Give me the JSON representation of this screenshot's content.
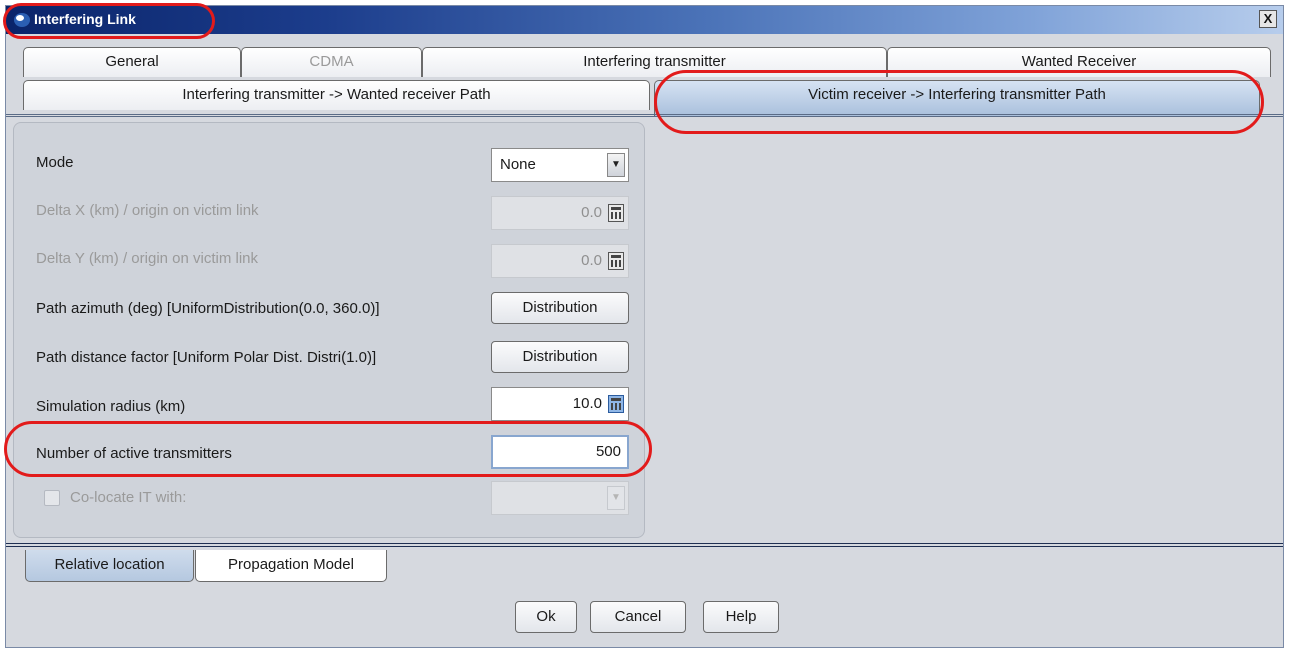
{
  "window": {
    "title": "Interfering Link",
    "close_label": "X"
  },
  "tabs_row1": [
    {
      "label": "General",
      "enabled": true
    },
    {
      "label": "CDMA",
      "enabled": false
    },
    {
      "label": "Interfering transmitter",
      "enabled": true
    },
    {
      "label": "Wanted Receiver",
      "enabled": true
    }
  ],
  "tabs_row2": [
    {
      "label": "Interfering transmitter -> Wanted receiver Path",
      "selected": false
    },
    {
      "label": "Victim receiver -> Interfering transmitter Path",
      "selected": true
    }
  ],
  "form": {
    "mode": {
      "label": "Mode",
      "value": "None"
    },
    "delta_x": {
      "label": "Delta X (km) / origin on victim link",
      "value": "0.0",
      "enabled": false
    },
    "delta_y": {
      "label": "Delta Y (km) / origin on victim link",
      "value": "0.0",
      "enabled": false
    },
    "path_azimuth": {
      "label": "Path azimuth (deg) [UniformDistribution(0.0, 360.0)]",
      "button_label": "Distribution"
    },
    "path_distance": {
      "label": "Path distance factor [Uniform Polar Dist. Distri(1.0)]",
      "button_label": "Distribution"
    },
    "sim_radius": {
      "label": "Simulation radius (km)",
      "value": "10.0"
    },
    "active_tx": {
      "label": "Number of active transmitters",
      "value": "500"
    },
    "colocate": {
      "label": "Co-locate IT with:",
      "checked": false,
      "enabled": false,
      "value": ""
    }
  },
  "bottom_tabs": [
    {
      "label": "Relative location",
      "selected": true
    },
    {
      "label": "Propagation Model",
      "selected": false
    }
  ],
  "buttons": {
    "ok": "Ok",
    "cancel": "Cancel",
    "help": "Help"
  },
  "colors": {
    "annotation": "#e21b1b",
    "titlebar_start": "#0a246a",
    "titlebar_end": "#b7cdec"
  }
}
